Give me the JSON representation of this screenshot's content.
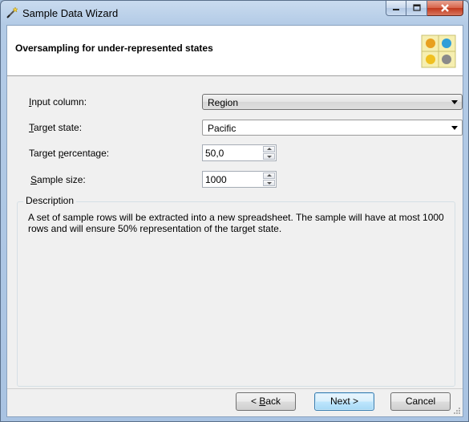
{
  "window": {
    "title": "Sample Data Wizard"
  },
  "header": {
    "title": "Oversampling for under-represented states"
  },
  "fields": {
    "input_column": {
      "label_ul": "I",
      "label_rest": "nput column:",
      "value": "Region"
    },
    "target_state": {
      "label_ul": "T",
      "label_rest": "arget state:",
      "value": "Pacific"
    },
    "target_percentage": {
      "label_pre": "Target ",
      "label_ul": "p",
      "label_rest": "ercentage:",
      "value": "50,0"
    },
    "sample_size": {
      "label_ul": "S",
      "label_rest": "ample size:",
      "value": "1000"
    }
  },
  "description": {
    "legend": "Description",
    "text": "A set of sample rows will be extracted into a new spreadsheet. The sample will have at most 1000 rows and will ensure 50% representation of the target state."
  },
  "buttons": {
    "back_prefix": "< ",
    "back_ul": "B",
    "back_rest": "ack",
    "next": "Next >",
    "cancel": "Cancel"
  },
  "colors": {
    "logo": [
      "#e8a020",
      "#2f9ed8",
      "#f0c020",
      "#8a8a8a"
    ]
  }
}
